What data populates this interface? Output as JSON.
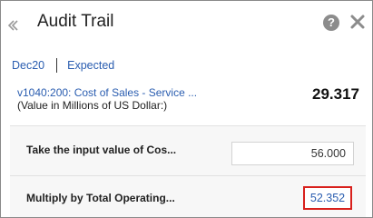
{
  "header": {
    "title": "Audit Trail",
    "back_icon": "chevron-left-icon",
    "help_icon": "question-circle-icon",
    "help_glyph": "?",
    "close_icon": "close-icon"
  },
  "breadcrumbs": [
    {
      "label": "Dec20"
    },
    {
      "label": "Expected"
    }
  ],
  "account": {
    "name": "v1040:200: Cost of Sales - Service ...",
    "units": "(Value in Millions of US Dollar:)",
    "value": "29.317"
  },
  "steps": [
    {
      "label": "Take the input value of Cos...",
      "value": "56.000"
    },
    {
      "label": "Multiply by Total Operating...",
      "value": "52.352"
    }
  ],
  "colors": {
    "link": "#2a5db0",
    "highlight_border": "#d8201c"
  }
}
